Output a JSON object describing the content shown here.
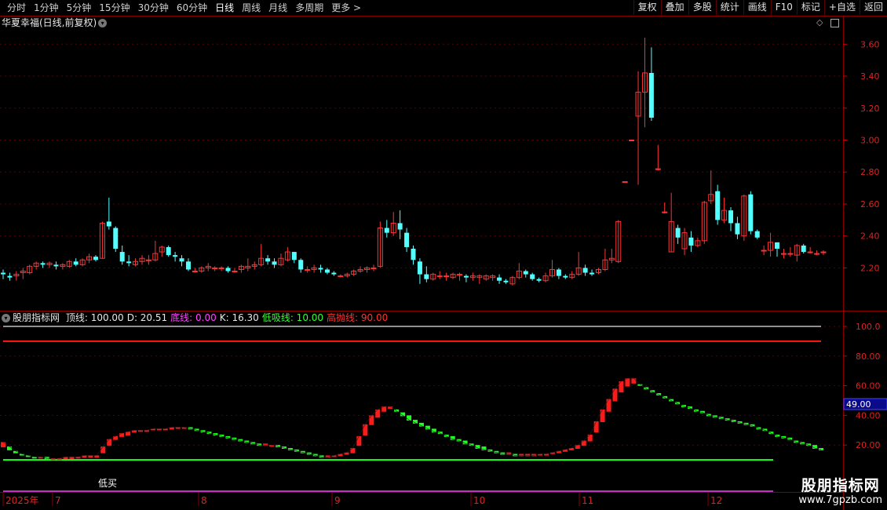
{
  "toolbar": {
    "tabs": [
      "分时",
      "1分钟",
      "5分钟",
      "15分钟",
      "30分钟",
      "60分钟",
      "日线",
      "周线",
      "月线",
      "多周期",
      "更多 >"
    ],
    "active_tab": "日线",
    "right_buttons": [
      "复权",
      "叠加",
      "多股",
      "统计",
      "画线",
      "F10",
      "标记",
      "+自选",
      "返回"
    ]
  },
  "main_panel": {
    "title": "华夏幸福(日线,前复权)",
    "price_ticks": [
      "3.60",
      "3.40",
      "3.20",
      "3.00",
      "2.80",
      "2.60",
      "2.40",
      "2.20"
    ]
  },
  "indicator": {
    "name": "股朋指标网",
    "items": [
      {
        "label": "顶线: 100.00",
        "color": "#e6e6e6"
      },
      {
        "label": "D: 20.51",
        "color": "#e6e6e6"
      },
      {
        "label": "底线: 0.00",
        "color": "#ff44ff"
      },
      {
        "label": "K: 16.30",
        "color": "#e6e6e6"
      },
      {
        "label": "低吸线: 10.00",
        "color": "#33ff33"
      },
      {
        "label": "高抛线: 90.00",
        "color": "#ff3333"
      }
    ],
    "value_ticks": [
      "100.0",
      "80.00",
      "60.00",
      "40.00",
      "20.00"
    ],
    "current_value": "49.00",
    "low_buy_marker": "低买"
  },
  "time_axis": [
    "2025年",
    "7",
    "8",
    "9",
    "10",
    "11",
    "12"
  ],
  "watermark": {
    "line1": "股朋指标网",
    "line2": "www.7gpzb.com"
  },
  "colors": {
    "up": "#ff3333",
    "down": "#54ffff",
    "grid": "#5a0000",
    "k_rise": "#ff1a1a",
    "k_fall": "#22ff22"
  },
  "chart_data": [
    {
      "type": "candlestick",
      "title": "华夏幸福(日线,前复权)",
      "ylim": [
        2.05,
        3.68
      ],
      "y_ticks": [
        2.2,
        2.4,
        2.6,
        2.8,
        3.0,
        3.2,
        3.4,
        3.6
      ],
      "candles": [
        [
          2.17,
          2.16,
          2.19,
          2.13
        ],
        [
          2.15,
          2.14,
          2.17,
          2.12
        ],
        [
          2.15,
          2.16,
          2.18,
          2.12
        ],
        [
          2.17,
          2.18,
          2.2,
          2.13
        ],
        [
          2.17,
          2.21,
          2.22,
          2.16
        ],
        [
          2.21,
          2.23,
          2.24,
          2.19
        ],
        [
          2.23,
          2.22,
          2.24,
          2.2
        ],
        [
          2.22,
          2.23,
          2.24,
          2.2
        ],
        [
          2.22,
          2.21,
          2.24,
          2.19
        ],
        [
          2.21,
          2.22,
          2.23,
          2.19
        ],
        [
          2.21,
          2.24,
          2.25,
          2.2
        ],
        [
          2.24,
          2.22,
          2.26,
          2.21
        ],
        [
          2.22,
          2.25,
          2.26,
          2.21
        ],
        [
          2.25,
          2.27,
          2.29,
          2.23
        ],
        [
          2.27,
          2.25,
          2.28,
          2.24
        ],
        [
          2.26,
          2.48,
          2.49,
          2.26
        ],
        [
          2.49,
          2.46,
          2.64,
          2.44
        ],
        [
          2.45,
          2.32,
          2.46,
          2.3
        ],
        [
          2.3,
          2.24,
          2.34,
          2.22
        ],
        [
          2.24,
          2.23,
          2.28,
          2.21
        ],
        [
          2.22,
          2.24,
          2.26,
          2.21
        ],
        [
          2.24,
          2.26,
          2.28,
          2.22
        ],
        [
          2.25,
          2.25,
          2.28,
          2.22
        ],
        [
          2.25,
          2.29,
          2.37,
          2.24
        ],
        [
          2.3,
          2.33,
          2.34,
          2.27
        ],
        [
          2.33,
          2.28,
          2.34,
          2.27
        ],
        [
          2.28,
          2.27,
          2.3,
          2.24
        ],
        [
          2.26,
          2.24,
          2.28,
          2.21
        ],
        [
          2.24,
          2.19,
          2.26,
          2.18
        ],
        [
          2.18,
          2.18,
          2.2,
          2.17
        ],
        [
          2.18,
          2.2,
          2.21,
          2.17
        ],
        [
          2.2,
          2.21,
          2.23,
          2.18
        ],
        [
          2.2,
          2.2,
          2.21,
          2.18
        ],
        [
          2.2,
          2.2,
          2.21,
          2.18
        ],
        [
          2.2,
          2.18,
          2.21,
          2.17
        ],
        [
          2.18,
          2.18,
          2.2,
          2.17
        ],
        [
          2.19,
          2.21,
          2.22,
          2.17
        ],
        [
          2.2,
          2.21,
          2.26,
          2.18
        ],
        [
          2.21,
          2.22,
          2.24,
          2.19
        ],
        [
          2.22,
          2.26,
          2.35,
          2.21
        ],
        [
          2.26,
          2.24,
          2.28,
          2.22
        ],
        [
          2.24,
          2.22,
          2.26,
          2.2
        ],
        [
          2.22,
          2.26,
          2.29,
          2.21
        ],
        [
          2.25,
          2.3,
          2.33,
          2.24
        ],
        [
          2.3,
          2.25,
          2.3,
          2.23
        ],
        [
          2.25,
          2.19,
          2.26,
          2.17
        ],
        [
          2.19,
          2.19,
          2.21,
          2.17
        ],
        [
          2.19,
          2.2,
          2.22,
          2.17
        ],
        [
          2.2,
          2.19,
          2.22,
          2.17
        ],
        [
          2.19,
          2.17,
          2.2,
          2.16
        ],
        [
          2.17,
          2.16,
          2.18,
          2.15
        ],
        [
          2.15,
          2.15,
          2.16,
          2.14
        ],
        [
          2.15,
          2.16,
          2.17,
          2.14
        ],
        [
          2.16,
          2.18,
          2.19,
          2.15
        ],
        [
          2.18,
          2.19,
          2.21,
          2.17
        ],
        [
          2.19,
          2.2,
          2.21,
          2.17
        ],
        [
          2.2,
          2.2,
          2.22,
          2.18
        ],
        [
          2.21,
          2.45,
          2.49,
          2.2
        ],
        [
          2.45,
          2.42,
          2.5,
          2.39
        ],
        [
          2.42,
          2.48,
          2.55,
          2.4
        ],
        [
          2.48,
          2.44,
          2.56,
          2.38
        ],
        [
          2.42,
          2.33,
          2.45,
          2.3
        ],
        [
          2.32,
          2.25,
          2.34,
          2.22
        ],
        [
          2.24,
          2.16,
          2.26,
          2.1
        ],
        [
          2.16,
          2.13,
          2.21,
          2.11
        ],
        [
          2.13,
          2.16,
          2.17,
          2.12
        ],
        [
          2.15,
          2.15,
          2.18,
          2.13
        ],
        [
          2.15,
          2.15,
          2.17,
          2.12
        ],
        [
          2.14,
          2.16,
          2.17,
          2.13
        ],
        [
          2.16,
          2.16,
          2.17,
          2.12
        ],
        [
          2.15,
          2.14,
          2.16,
          2.11
        ],
        [
          2.14,
          2.15,
          2.17,
          2.12
        ],
        [
          2.14,
          2.15,
          2.16,
          2.1
        ],
        [
          2.13,
          2.15,
          2.16,
          2.12
        ],
        [
          2.14,
          2.15,
          2.16,
          2.12
        ],
        [
          2.14,
          2.12,
          2.16,
          2.1
        ],
        [
          2.12,
          2.11,
          2.13,
          2.1
        ],
        [
          2.1,
          2.14,
          2.15,
          2.09
        ],
        [
          2.14,
          2.18,
          2.23,
          2.13
        ],
        [
          2.18,
          2.16,
          2.19,
          2.14
        ],
        [
          2.16,
          2.13,
          2.17,
          2.12
        ],
        [
          2.13,
          2.12,
          2.14,
          2.11
        ],
        [
          2.12,
          2.15,
          2.17,
          2.11
        ],
        [
          2.15,
          2.19,
          2.25,
          2.14
        ],
        [
          2.19,
          2.15,
          2.2,
          2.13
        ],
        [
          2.15,
          2.14,
          2.16,
          2.13
        ],
        [
          2.14,
          2.16,
          2.18,
          2.13
        ],
        [
          2.16,
          2.2,
          2.3,
          2.15
        ],
        [
          2.2,
          2.17,
          2.22,
          2.15
        ],
        [
          2.17,
          2.16,
          2.19,
          2.15
        ],
        [
          2.17,
          2.19,
          2.2,
          2.16
        ],
        [
          2.19,
          2.25,
          2.32,
          2.18
        ],
        [
          2.25,
          2.26,
          2.32,
          2.23
        ],
        [
          2.24,
          2.49,
          2.5,
          2.23
        ],
        [
          2.74,
          2.74,
          2.74,
          2.74
        ],
        [
          3.0,
          3.0,
          3.0,
          3.0
        ],
        [
          3.15,
          3.3,
          3.43,
          2.72
        ],
        [
          3.3,
          3.42,
          3.64,
          3.08
        ],
        [
          3.42,
          3.14,
          3.58,
          3.12
        ],
        [
          2.82,
          2.82,
          2.97,
          2.81
        ],
        [
          2.55,
          2.55,
          2.61,
          2.54
        ],
        [
          2.3,
          2.49,
          2.67,
          2.3
        ],
        [
          2.45,
          2.39,
          2.47,
          2.35
        ],
        [
          2.32,
          2.42,
          2.45,
          2.28
        ],
        [
          2.39,
          2.34,
          2.43,
          2.3
        ],
        [
          2.34,
          2.37,
          2.39,
          2.33
        ],
        [
          2.37,
          2.61,
          2.62,
          2.35
        ],
        [
          2.62,
          2.66,
          2.81,
          2.6
        ],
        [
          2.68,
          2.5,
          2.72,
          2.47
        ],
        [
          2.5,
          2.56,
          2.64,
          2.48
        ],
        [
          2.56,
          2.48,
          2.58,
          2.43
        ],
        [
          2.48,
          2.41,
          2.52,
          2.38
        ],
        [
          2.4,
          2.65,
          2.66,
          2.37
        ],
        [
          2.66,
          2.43,
          2.68,
          2.41
        ],
        [
          2.43,
          2.39,
          2.44,
          2.38
        ],
        [
          2.31,
          2.31,
          2.34,
          2.28
        ],
        [
          2.31,
          2.36,
          2.42,
          2.27
        ],
        [
          2.36,
          2.32,
          2.36,
          2.27
        ],
        [
          2.29,
          2.29,
          2.32,
          2.26
        ],
        [
          2.29,
          2.29,
          2.33,
          2.27
        ],
        [
          2.28,
          2.34,
          2.35,
          2.24
        ],
        [
          2.34,
          2.3,
          2.35,
          2.29
        ],
        [
          2.3,
          2.3,
          2.33,
          2.29
        ],
        [
          2.29,
          2.29,
          2.31,
          2.28
        ],
        [
          2.3,
          2.3,
          2.31,
          2.28
        ]
      ]
    },
    {
      "type": "bar",
      "title": "股朋指标网",
      "ylim": [
        0,
        110
      ],
      "y_ticks": [
        20,
        40,
        60,
        80,
        100
      ],
      "lines": [
        {
          "name": "顶线",
          "value": 100
        },
        {
          "name": "高抛线",
          "value": 90
        },
        {
          "name": "低吸线",
          "value": 10
        },
        {
          "name": "底线",
          "value": 0
        }
      ],
      "series": [
        {
          "name": "K",
          "values": [
            22,
            19,
            16,
            14,
            13,
            12,
            12,
            11,
            11,
            11,
            12,
            12,
            12,
            13,
            13,
            13,
            19,
            24,
            26,
            28,
            29,
            30,
            30,
            30,
            31,
            31,
            31,
            32,
            32,
            32,
            31,
            30,
            29,
            28,
            27,
            26,
            25,
            24,
            23,
            22,
            21,
            20,
            20,
            20,
            19,
            18,
            17,
            16,
            15,
            14,
            13,
            12,
            12,
            13,
            14,
            15,
            18,
            26,
            34,
            40,
            44,
            46,
            46,
            43,
            40,
            37,
            35,
            33,
            31,
            29,
            28,
            26,
            24,
            23,
            21,
            20,
            18,
            17,
            16,
            15,
            14,
            14,
            13,
            13,
            13,
            13,
            14,
            14,
            15,
            16,
            17,
            18,
            20,
            23,
            27,
            36,
            44,
            51,
            58,
            63,
            65,
            65,
            61,
            58,
            56,
            54,
            52,
            50,
            48,
            46,
            45,
            43,
            42,
            40,
            39,
            38,
            37,
            36,
            35,
            34,
            33,
            31,
            30,
            28,
            26,
            25,
            24,
            22,
            21,
            20,
            18,
            17
          ]
        },
        {
          "name": "D",
          "values": [
            19,
            17,
            15,
            14,
            13,
            12,
            12,
            12,
            11,
            11,
            11,
            11,
            12,
            12,
            12,
            12,
            15,
            20,
            24,
            26,
            27,
            29,
            30,
            30,
            31,
            31,
            31,
            31,
            32,
            32,
            32,
            31,
            30,
            29,
            28,
            27,
            26,
            25,
            24,
            23,
            22,
            21,
            21,
            20,
            20,
            19,
            18,
            17,
            16,
            15,
            14,
            13,
            13,
            13,
            13,
            14,
            15,
            20,
            27,
            34,
            39,
            43,
            45,
            44,
            42,
            40,
            37,
            35,
            33,
            31,
            29,
            27,
            26,
            24,
            23,
            21,
            20,
            19,
            17,
            16,
            15,
            15,
            14,
            14,
            14,
            14,
            14,
            14,
            15,
            15,
            16,
            17,
            18,
            20,
            23,
            29,
            36,
            43,
            50,
            56,
            60,
            62,
            61,
            59,
            57,
            55,
            53,
            51,
            49,
            47,
            46,
            44,
            43,
            41,
            40,
            39,
            38,
            37,
            36,
            35,
            34,
            32,
            31,
            29,
            27,
            26,
            25,
            23,
            22,
            21,
            20,
            18
          ]
        }
      ]
    }
  ]
}
